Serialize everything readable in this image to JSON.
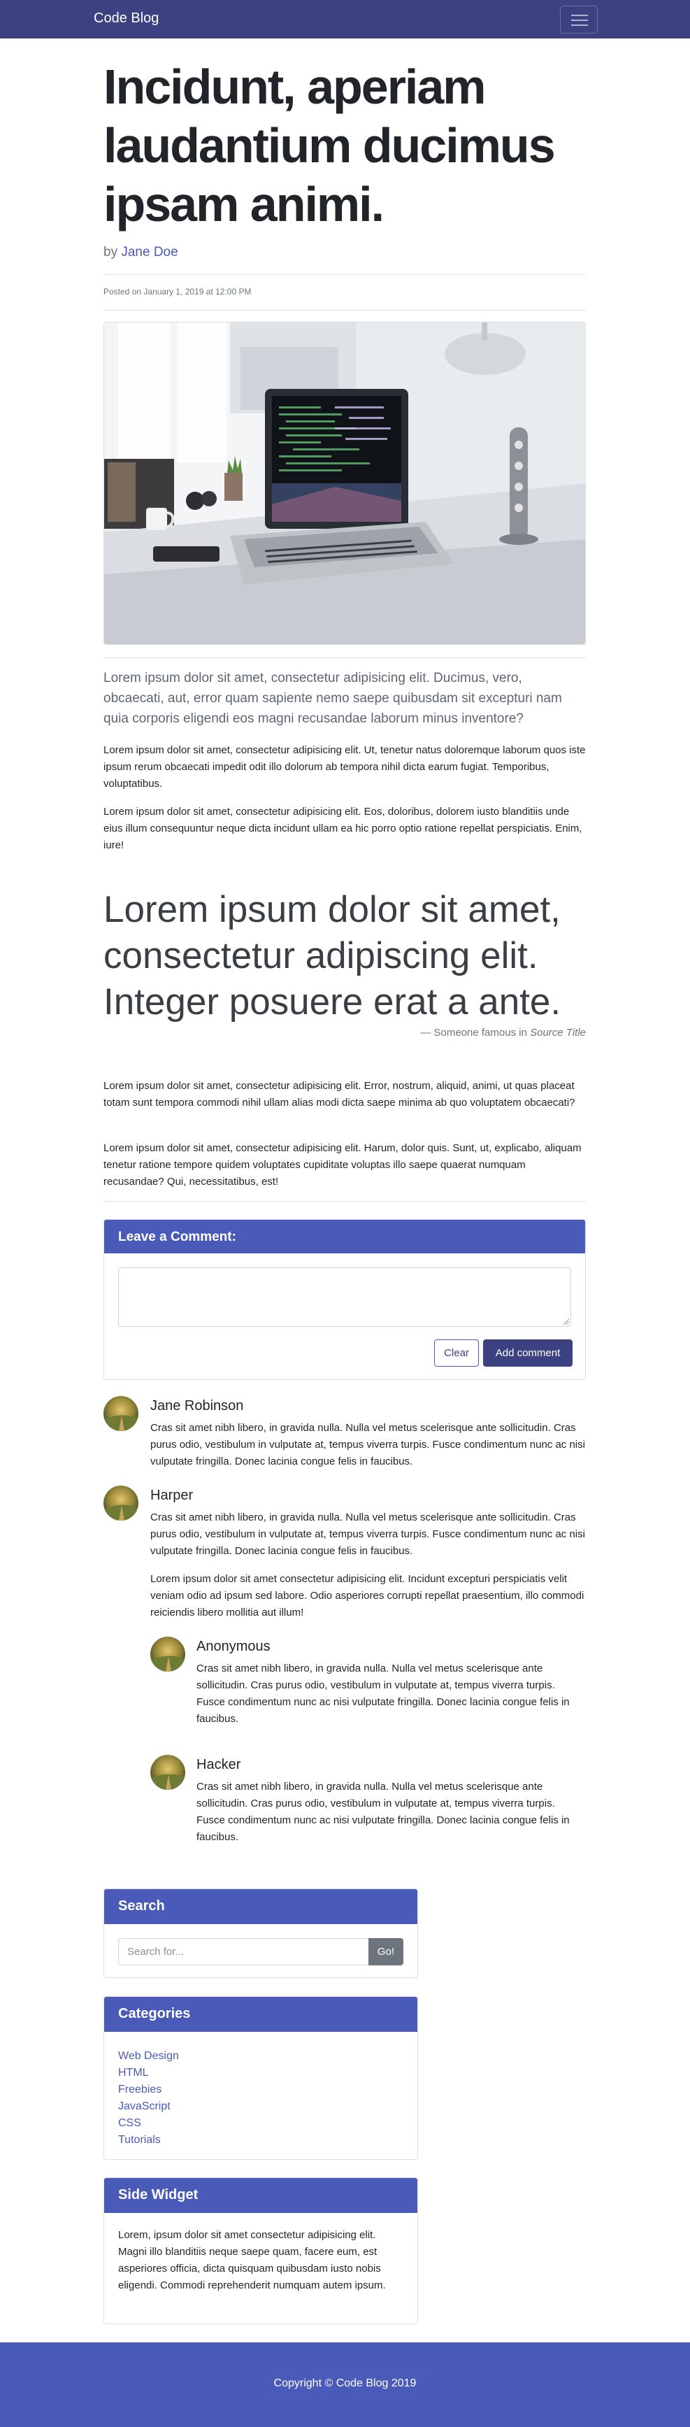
{
  "navbar": {
    "brand": "Code Blog"
  },
  "post": {
    "title": "Incidunt, aperiam laudantium ducimus ipsam animi.",
    "by_prefix": "by",
    "author": "Jane Doe",
    "posted": "Posted on January 1, 2019 at 12:00 PM",
    "lead": "Lorem ipsum dolor sit amet, consectetur adipisicing elit. Ducimus, vero, obcaecati, aut, error quam sapiente nemo saepe quibusdam sit excepturi nam quia corporis eligendi eos magni recusandae laborum minus inventore?",
    "paragraphs": [
      "Lorem ipsum dolor sit amet, consectetur adipisicing elit. Ut, tenetur natus doloremque laborum quos iste ipsum rerum obcaecati impedit odit illo dolorum ab tempora nihil dicta earum fugiat. Temporibus, voluptatibus.",
      "Lorem ipsum dolor sit amet, consectetur adipisicing elit. Eos, doloribus, dolorem iusto blanditiis unde eius illum consequuntur neque dicta incidunt ullam ea hic porro optio ratione repellat perspiciatis. Enim, iure!",
      "Lorem ipsum dolor sit amet, consectetur adipisicing elit. Error, nostrum, aliquid, animi, ut quas placeat totam sunt tempora commodi nihil ullam alias modi dicta saepe minima ab quo voluptatem obcaecati?",
      "Lorem ipsum dolor sit amet, consectetur adipisicing elit. Harum, dolor quis. Sunt, ut, explicabo, aliquam tenetur ratione tempore quidem voluptates cupiditate voluptas illo saepe quaerat numquam recusandae? Qui, necessitatibus, est!"
    ],
    "quote": "Lorem ipsum dolor sit amet, consectetur adipiscing elit. Integer posuere erat a ante.",
    "quote_prefix": "— Someone famous in",
    "quote_source": "Source Title"
  },
  "comment_form": {
    "header": "Leave a Comment:",
    "clear_label": "Clear",
    "add_label": "Add comment"
  },
  "comments": [
    {
      "name": "Jane Robinson",
      "text": "Cras sit amet nibh libero, in gravida nulla. Nulla vel metus scelerisque ante sollicitudin. Cras purus odio, vestibulum in vulputate at, tempus viverra turpis. Fusce condimentum nunc ac nisi vulputate fringilla. Donec lacinia congue felis in faucibus."
    },
    {
      "name": "Harper",
      "text": "Cras sit amet nibh libero, in gravida nulla. Nulla vel metus scelerisque ante sollicitudin. Cras purus odio, vestibulum in vulputate at, tempus viverra turpis. Fusce condimentum nunc ac nisi vulputate fringilla. Donec lacinia congue felis in faucibus.",
      "extra": "Lorem ipsum dolor sit amet consectetur adipisicing elit. Incidunt excepturi perspiciatis velit veniam odio ad ipsum sed labore. Odio asperiores corrupti repellat praesentium, illo commodi reiciendis libero mollitia aut illum!"
    }
  ],
  "replies": [
    {
      "name": "Anonymous",
      "text": "Cras sit amet nibh libero, in gravida nulla. Nulla vel metus scelerisque ante sollicitudin. Cras purus odio, vestibulum in vulputate at, tempus viverra turpis. Fusce condimentum nunc ac nisi vulputate fringilla. Donec lacinia congue felis in faucibus."
    },
    {
      "name": "Hacker",
      "text": "Cras sit amet nibh libero, in gravida nulla. Nulla vel metus scelerisque ante sollicitudin. Cras purus odio, vestibulum in vulputate at, tempus viverra turpis. Fusce condimentum nunc ac nisi vulputate fringilla. Donec lacinia congue felis in faucibus."
    }
  ],
  "sidebar": {
    "search": {
      "header": "Search",
      "placeholder": "Search for...",
      "button": "Go!"
    },
    "categories": {
      "header": "Categories",
      "items": [
        "Web Design",
        "HTML",
        "Freebies",
        "JavaScript",
        "CSS",
        "Tutorials"
      ]
    },
    "widget": {
      "header": "Side Widget",
      "text": "Lorem, ipsum dolor sit amet consectetur adipisicing elit. Magni illo blanditiis neque saepe quam, facere eum, est asperiores officia, dicta quisquam quibusdam iusto nobis eligendi. Commodi reprehenderit numquam autem ipsum."
    }
  },
  "footer": {
    "copyright": "Copyright © Code Blog 2019"
  },
  "colors": {
    "navbar": "#3b4181",
    "accent": "#4a5ab8",
    "footer": "#4a5ab8"
  }
}
